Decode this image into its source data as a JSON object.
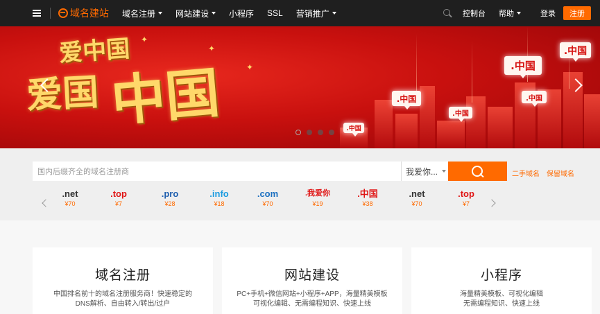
{
  "nav": {
    "logo_text": "域名建站",
    "items": [
      {
        "label": "域名注册",
        "has_dropdown": true
      },
      {
        "label": "网站建设",
        "has_dropdown": true
      },
      {
        "label": "小程序",
        "has_dropdown": false
      },
      {
        "label": "SSL",
        "has_dropdown": false
      },
      {
        "label": "营销推广",
        "has_dropdown": true
      }
    ],
    "console": "控制台",
    "help": "帮助",
    "login": "登录",
    "register": "注册"
  },
  "banner": {
    "calligraphy_top": "爱中国",
    "calligraphy_left": "爱国",
    "calligraphy_big": "中国",
    "signs": [
      ".中国",
      ".中国",
      ".中国",
      ".中国",
      ".中国",
      ".中国"
    ],
    "slide_count": 4,
    "active_slide": 0
  },
  "search": {
    "placeholder": "国内后缀齐全的域名注册商",
    "suffix_selected": "我爱你...",
    "links": [
      "二手域名",
      "保留域名"
    ]
  },
  "tlds": [
    {
      "name": ".net",
      "price": "¥70",
      "color": "#333333"
    },
    {
      "name": ".top",
      "price": "¥7",
      "color": "#e01515"
    },
    {
      "name": ".pro",
      "price": "¥28",
      "color": "#1f5fae"
    },
    {
      "name": ".info",
      "price": "¥18",
      "color": "#1a9be0"
    },
    {
      "name": ".com",
      "price": "¥70",
      "color": "#1a6fc0"
    },
    {
      "name": ".我爱你",
      "price": "¥19",
      "color": "#e01515"
    },
    {
      "name": ".中国",
      "price": "¥38",
      "color": "#e01515"
    },
    {
      "name": ".net",
      "price": "¥70",
      "color": "#333333"
    },
    {
      "name": ".top",
      "price": "¥7",
      "color": "#e01515"
    }
  ],
  "cards": [
    {
      "title": "域名注册",
      "desc_line1": "中国排名前十的域名注册服务商！快速稳定的",
      "desc_line2": "DNS解析、自由转入/转出/过户"
    },
    {
      "title": "网站建设",
      "desc_line1": "PC+手机+微信网站+小程序+APP，海量精美模板",
      "desc_line2": "可视化编辑、无需编程知识、快速上线"
    },
    {
      "title": "小程序",
      "desc_line1": "海量精美模板、可视化编辑",
      "desc_line2": "无需编程知识、快速上线"
    }
  ],
  "colors": {
    "accent": "#ff6a00",
    "nav_bg": "#1f1f1f",
    "banner_red": "#c8100e"
  }
}
